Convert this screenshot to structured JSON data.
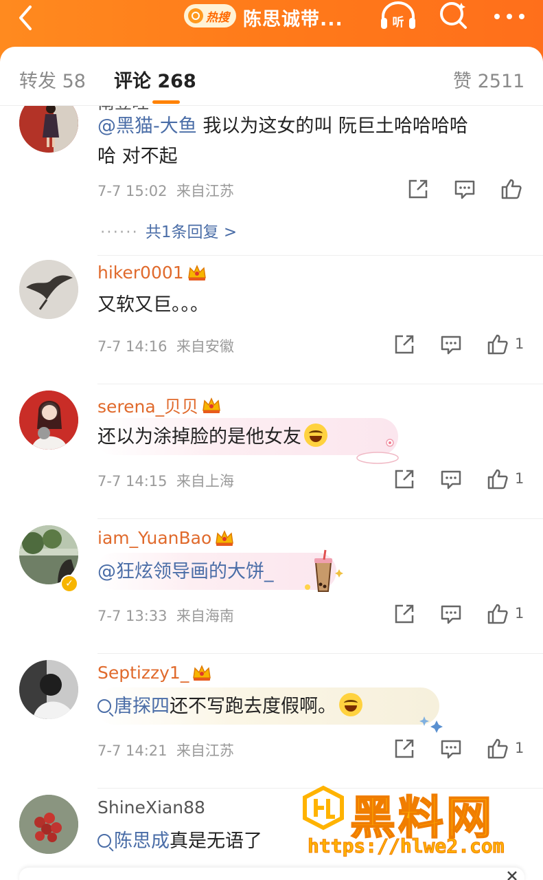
{
  "header": {
    "hot_search_label": "热搜",
    "title": "陈思诚带...",
    "listen_label": "听"
  },
  "tabs": {
    "repost": "转发 58",
    "comment": "评论 268",
    "like": "赞 2511"
  },
  "comments": [
    {
      "username": "南豆旺",
      "mention": "@黑猫-大鱼",
      "text_line1": " 我以为这女的叫 阮巨土哈哈哈哈",
      "text_line2": "哈 对不起",
      "time": "7-7 15:02",
      "location": "来自江苏",
      "likes": "",
      "replies_label": "共1条回复 >"
    },
    {
      "username": "hiker0001",
      "text": "又软又巨。。。",
      "time": "7-7 14:16",
      "location": "来自安徽",
      "likes": "1"
    },
    {
      "username": "serena_贝贝",
      "text": "还以为涂掉脸的是他女友",
      "time": "7-7 14:15",
      "location": "来自上海",
      "likes": "1"
    },
    {
      "username": "iam_YuanBao",
      "mention": "@狂炫领导画的大饼_",
      "time": "7-7 13:33",
      "location": "来自海南",
      "likes": "1"
    },
    {
      "username": "Septizzy1_",
      "topic": "唐探四",
      "text": "还不写跑去度假啊。",
      "time": "7-7 14:21",
      "location": "来自江苏",
      "likes": "1"
    },
    {
      "username": "ShineXian88",
      "topic": "陈思成",
      "text": "真是无语了"
    }
  ],
  "watermark": {
    "title": "黑料网",
    "url": "https://hlwe2.com"
  },
  "colors": {
    "header_orange": "#ff7a1a",
    "accent": "#ff8200",
    "username": "#e06a2c",
    "link": "#4a6da7"
  }
}
